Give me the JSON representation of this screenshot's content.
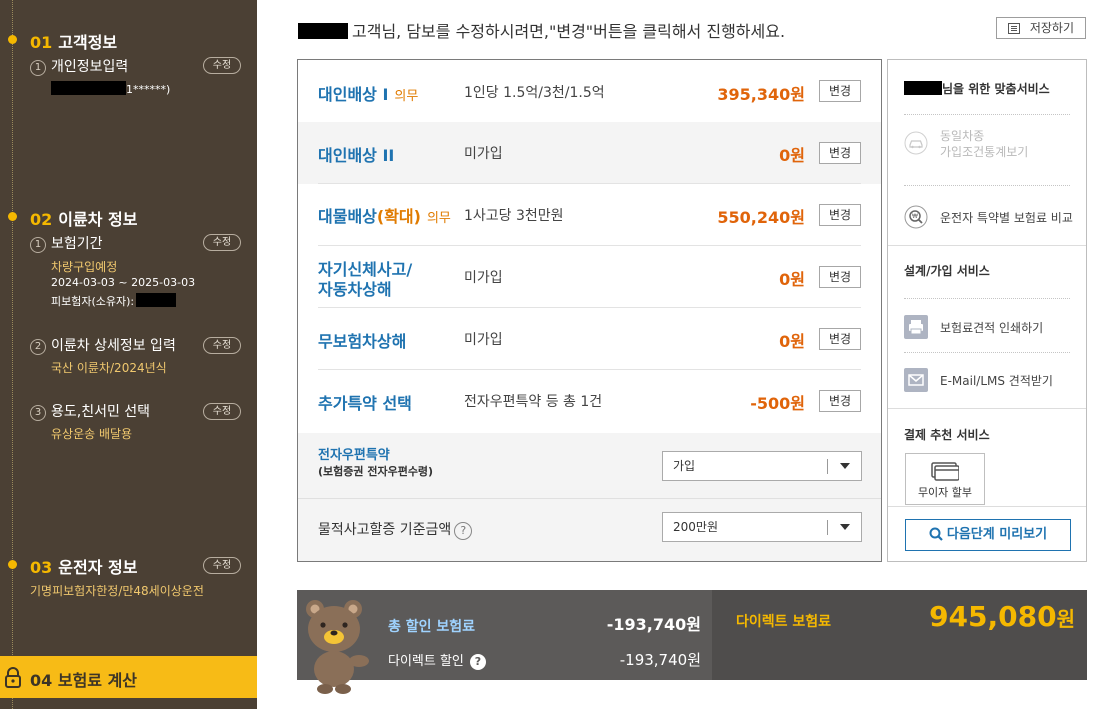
{
  "sidebar": {
    "edit_label": "수정",
    "step1": {
      "num": "01",
      "title": "고객정보",
      "sub1": {
        "num": "1",
        "title": "개인정보입력",
        "value": "1******)"
      }
    },
    "step2": {
      "num": "02",
      "title": "이륜차 정보",
      "sub1": {
        "num": "1",
        "title": "보험기간",
        "line1": "차량구입예정",
        "line2": "2024-03-03 ~ 2025-03-03",
        "line3": "피보험자(소유자):"
      },
      "sub2": {
        "num": "2",
        "title": "이륜차 상세정보 입력",
        "value": "국산 이륜차/2024년식"
      },
      "sub3": {
        "num": "3",
        "title": "용도,친서민 선택",
        "value": "유상운송 배달용"
      }
    },
    "step3": {
      "num": "03",
      "title": "운전자 정보",
      "value": "기명피보험자한정/만48세이상운전"
    },
    "step4": {
      "num": "04",
      "title": "보험료 계산"
    }
  },
  "header": {
    "notice": "고객님, 담보를 수정하시려면,\"변경\"버튼을 클릭해서 진행하세요.",
    "save_label": "저장하기"
  },
  "coverages": [
    {
      "name": "대인배상 I",
      "must": "의무",
      "desc": "1인당 1.5억/3천/1.5억",
      "amount": "395,340원",
      "button": "변경"
    },
    {
      "name": "대인배상 II",
      "desc": "미가입",
      "amount": "0원",
      "button": "변경"
    },
    {
      "name": "대물배상",
      "name_accent": "(확대)",
      "must": "의무",
      "desc": "1사고당 3천만원",
      "amount": "550,240원",
      "button": "변경"
    },
    {
      "name_line1": "자기신체사고/",
      "name_line2": "자동차상해",
      "desc": "미가입",
      "amount": "0원",
      "button": "변경"
    },
    {
      "name": "무보험차상해",
      "desc": "미가입",
      "amount": "0원",
      "button": "변경"
    },
    {
      "name": "추가특약 선택",
      "desc": "전자우편특약 등 총 1건",
      "amount": "-500원",
      "button": "변경"
    }
  ],
  "options": {
    "email_label": "전자우편특약",
    "email_sub": "(보험증권 전자우편수령)",
    "email_value": "가입",
    "property_label": "물적사고할증 기준금액",
    "property_value": "200만원"
  },
  "services": {
    "title_suffix": "님을 위한 맞춤서비스",
    "same_car_line1": "동일차종",
    "same_car_line2": "가입조건통계보기",
    "compare": "운전자 특약별 보험료 비교",
    "design_title": "설계/가입 서비스",
    "print": "보험료견적 인쇄하기",
    "email": "E-Mail/LMS 견적받기",
    "pay_title": "결제 추천 서비스",
    "pay_button": "무이자 할부",
    "preview_button": "다음단계 미리보기"
  },
  "summary": {
    "discount_label": "총 할인 보험료",
    "discount_value": "-193,740원",
    "direct_discount_label": "다이렉트 할인",
    "direct_discount_value": "-193,740원",
    "direct_label": "다이렉트 보험료",
    "direct_value": "945,080",
    "direct_unit": "원"
  },
  "colors": {
    "sidebar_bg": "#4b4034",
    "accent_yellow": "#f5b800",
    "coverage_blue": "#1f73b0",
    "amount_orange": "#e0640a"
  }
}
